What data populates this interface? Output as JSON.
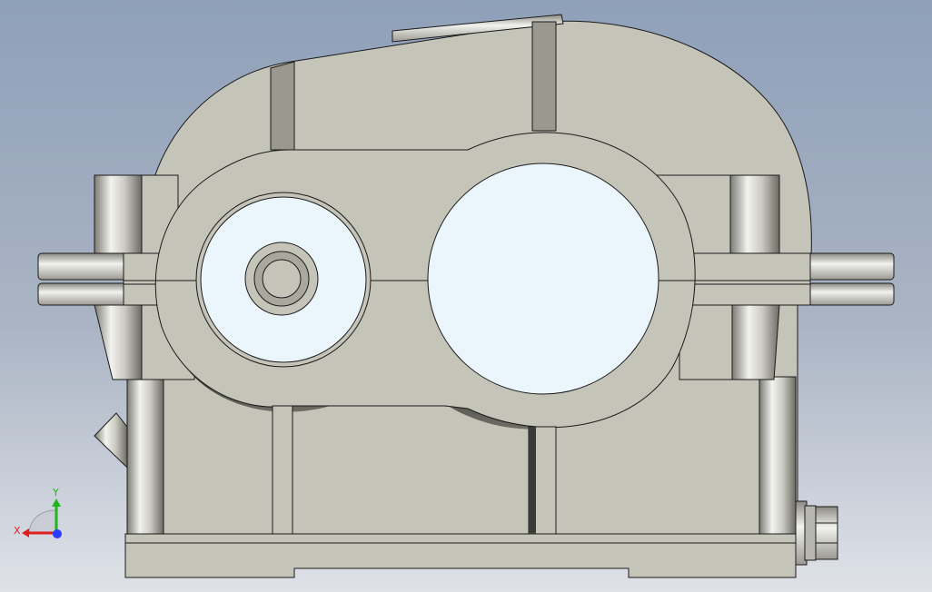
{
  "triad": {
    "x_label": "X",
    "y_label": "Y",
    "x_color": "#e02020",
    "y_color": "#1fb51f",
    "z_color": "#2a3cff"
  },
  "colors": {
    "body": "#c5c4b8",
    "body_dark": "#7d7c73",
    "glass": "#eaf6fb",
    "outline": "#1a1a1a",
    "metal_light": "#f4f4f0",
    "metal_mid": "#bdbcb4",
    "metal_dark": "#6d6c66"
  }
}
